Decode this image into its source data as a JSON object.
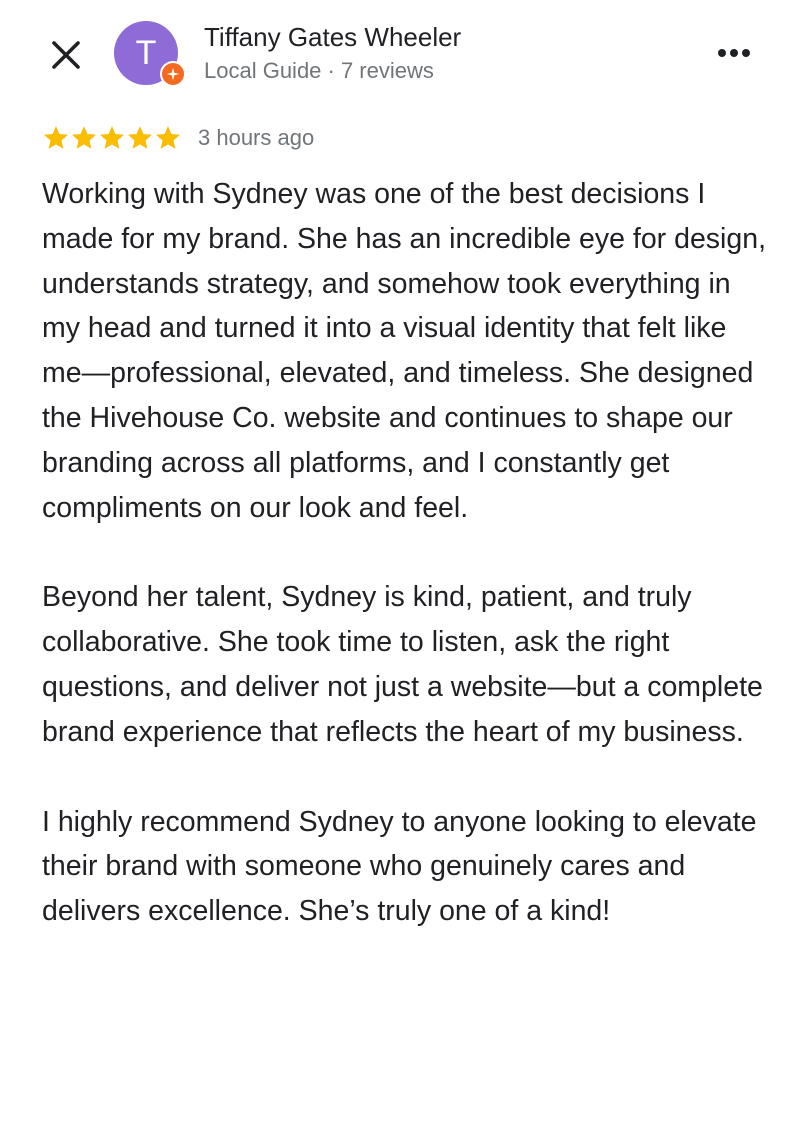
{
  "header": {
    "close_icon": "close-icon",
    "avatar_initial": "T",
    "avatar_color": "#8e6bd6",
    "badge_icon": "local-guide-star-icon",
    "badge_color": "#f26b21",
    "user_name": "Tiffany Gates Wheeler",
    "user_meta": "Local Guide · 7 reviews",
    "more_icon": "more-horizontal-icon"
  },
  "rating": {
    "stars": 5,
    "star_color": "#fbbc04",
    "time_ago": "3 hours ago"
  },
  "review": {
    "paragraphs": [
      "Working with Sydney was one of the best decisions I made for my brand. She has an incredible eye for design, understands strategy, and somehow took everything in my head and turned it into a visual identity that felt like me—professional, elevated, and timeless. She designed the Hivehouse Co. website and continues to shape our branding across all platforms, and I constantly get compliments on our look and feel.",
      "Beyond her talent, Sydney is kind, patient, and truly collaborative. She took time to listen, ask the right questions, and deliver not just a website—but a complete brand experience that reflects the heart of my business.",
      "I highly recommend Sydney to anyone looking to elevate their brand with someone who genuinely cares and delivers excellence. She’s truly one of a kind!"
    ]
  }
}
